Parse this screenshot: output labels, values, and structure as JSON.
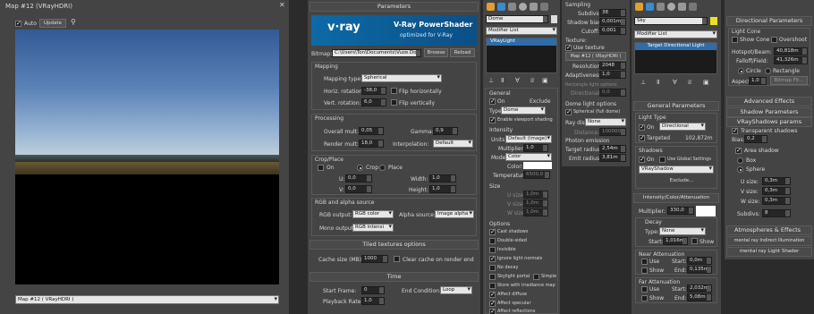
{
  "map_window": {
    "title": "Map #12  (VRayHDRI)",
    "auto": "Auto",
    "update": "Update",
    "bottom_select": "Map #12  ( VRayHDRI )"
  },
  "params": {
    "rollout": "Parameters",
    "logo": "v·ray",
    "logo_title": "V-Ray PowerShader",
    "logo_sub": "optimized for V-Ray",
    "bitmap_label": "Bitmap:",
    "bitmap_path": "C:\\Users\\Ton\\Documents\\Vuze.Do",
    "browse": "Browse",
    "reload": "Reload",
    "mapping": {
      "title": "Mapping",
      "type_label": "Mapping type:",
      "type_value": "Spherical",
      "horiz_label": "Horiz. rotation:",
      "horiz_value": "-38,0",
      "vert_label": "Vert. rotation:",
      "vert_value": "6,0",
      "flip_h": "Flip horizontally",
      "flip_v": "Flip vertically"
    },
    "processing": {
      "title": "Processing",
      "overall_label": "Overall mult:",
      "overall_value": "0,05",
      "gamma_label": "Gamma:",
      "gamma_value": "0,9",
      "render_label": "Render mult:",
      "render_value": "18,0",
      "interp_label": "Interpolation:",
      "interp_value": "Default"
    },
    "crop": {
      "title": "Crop/Place",
      "on": "On",
      "crop": "Crop",
      "place": "Place",
      "u_label": "U:",
      "u_value": "0,0",
      "v_label": "V:",
      "v_value": "0,0",
      "w_label": "Width:",
      "w_value": "1,0",
      "h_label": "Height:",
      "h_value": "1,0"
    },
    "rgb": {
      "title": "RGB and alpha source",
      "rgb_label": "RGB output:",
      "rgb_value": "RGB color",
      "alpha_label": "Alpha source:",
      "alpha_value": "Image alpha",
      "mono_label": "Mono output:",
      "mono_value": "RGB intensi"
    },
    "tiled": {
      "title": "Tiled textures options",
      "cache_label": "Cache size (MB):",
      "cache_value": "1000",
      "clear_label": "Clear cache on render end"
    },
    "time": {
      "title": "Time",
      "start_label": "Start Frame:",
      "start_value": "0",
      "rate_label": "Playback Rate:",
      "rate_value": "1,0",
      "end_label": "End Condition:",
      "end_value": "Loop"
    }
  },
  "dome": {
    "name": "Dome",
    "modifier_list": "Modifier List",
    "stack_item": "VRayLight",
    "general": {
      "title": "General",
      "on": "On",
      "exclude": "Exclude",
      "type_label": "Type:",
      "type_value": "Dome",
      "viewport": "Enable viewport shading"
    },
    "intensity": {
      "title": "Intensity",
      "units_label": "Units:",
      "units_value": "Default (image)",
      "mult_label": "Multiplier:",
      "mult_value": "1,0",
      "mode_label": "Mode:",
      "mode_value": "Color",
      "color_label": "Color:",
      "temp_label": "Temperature:",
      "temp_value": "6500,0"
    },
    "size": {
      "title": "Size",
      "u_label": "U size:",
      "u_value": "1,0m",
      "v_label": "V size:",
      "v_value": "1,0m",
      "w_label": "W size:",
      "w_value": "1,0m"
    },
    "options": {
      "title": "Options",
      "items": [
        "Cast shadows",
        "Double-sided",
        "Invisible",
        "Ignore light normals",
        "No decay",
        "Skylight portal",
        "Store with irradiance map",
        "Affect diffuse",
        "Affect specular",
        "Affect reflections"
      ],
      "simple": "Simple"
    }
  },
  "sampling": {
    "title": "Sampling",
    "subdivs_label": "Subdivs:",
    "subdivs_value": "38",
    "shadow_label": "Shadow bias:",
    "shadow_value": "0,001m",
    "cutoff_label": "Cutoff:",
    "cutoff_value": "0,001",
    "texture_title": "Texture:",
    "use_texture": "Use texture",
    "map": "Map #12 ( VRayHDRI )",
    "res_label": "Resolution:",
    "res_value": "2048",
    "adaptive_label": "Adaptiveness:",
    "adaptive_value": "1,0",
    "rect_title": "Rectangle light options",
    "directional_label": "Directional:",
    "directional_value": "0,0",
    "dome_title": "Dome light options",
    "spherical": "Spherical (full dome)",
    "ray_label": "Ray dist:",
    "ray_value": "None",
    "distance_label": "Distance:",
    "distance_value": "100000,0",
    "photon_title": "Photon emission",
    "target_label": "Target radius:",
    "target_value": "2,54m",
    "emit_label": "Emit radius:",
    "emit_value": "3,81m"
  },
  "sky": {
    "name": "Sky",
    "modifier_list": "Modifier List",
    "stack_item": "Target Directional Light",
    "general_title": "General Parameters",
    "light_type": "Light Type",
    "on": "On",
    "type_value": "Directional",
    "targeted": "Targeted",
    "targeted_value": "102,872m",
    "shadows_title": "Shadows",
    "use_global": "Use Global Settings",
    "shadow_type": "VRayShadow",
    "exclude": "Exclude...",
    "intensity_title": "Intensity/Color/Attenuation",
    "mult_label": "Multiplier:",
    "mult_value": "330,0",
    "decay_title": "Decay",
    "decay_type_label": "Type:",
    "decay_type_value": "None",
    "decay_start_label": "Start:",
    "decay_start_value": "1,016m",
    "show": "Show",
    "near_title": "Near Attenuation",
    "use": "Use",
    "start_label": "Start:",
    "near_start": "0,0m",
    "end_label": "End:",
    "near_end": "0,135m",
    "far_title": "Far Attenuation",
    "far_start": "2,032m",
    "far_end": "5,08m"
  },
  "right": {
    "dir_title": "Directional Parameters",
    "light_cone": "Light Cone",
    "show_cone": "Show Cone",
    "overshoot": "Overshoot",
    "hotspot_label": "Hotspot/Beam:",
    "hotspot_value": "40,818m",
    "falloff_label": "Falloff/Field:",
    "falloff_value": "41,326m",
    "circle": "Circle",
    "rectangle": "Rectangle",
    "aspect_label": "Aspect:",
    "aspect_value": "1,0",
    "bitmap_fit": "Bitmap Fit...",
    "advanced": "Advanced Effects",
    "shadow_params": "Shadow Parameters",
    "vray_title": "VRayShadows params",
    "transparent": "Transparent shadows",
    "bias_label": "Bias:",
    "bias_value": "0,2",
    "area": "Area shadow",
    "box": "Box",
    "sphere": "Sphere",
    "u_label": "U size:",
    "u_value": "0,3m",
    "v_label": "V size:",
    "v_value": "0,3m",
    "w_label": "W size:",
    "w_value": "0,3m",
    "subdivs_label": "Subdivs:",
    "subdivs_value": "8",
    "atmos": "Atmospheres & Effects",
    "mental_ill": "mental ray Indirect Illumination",
    "mental_shader": "mental ray Light Shader"
  }
}
